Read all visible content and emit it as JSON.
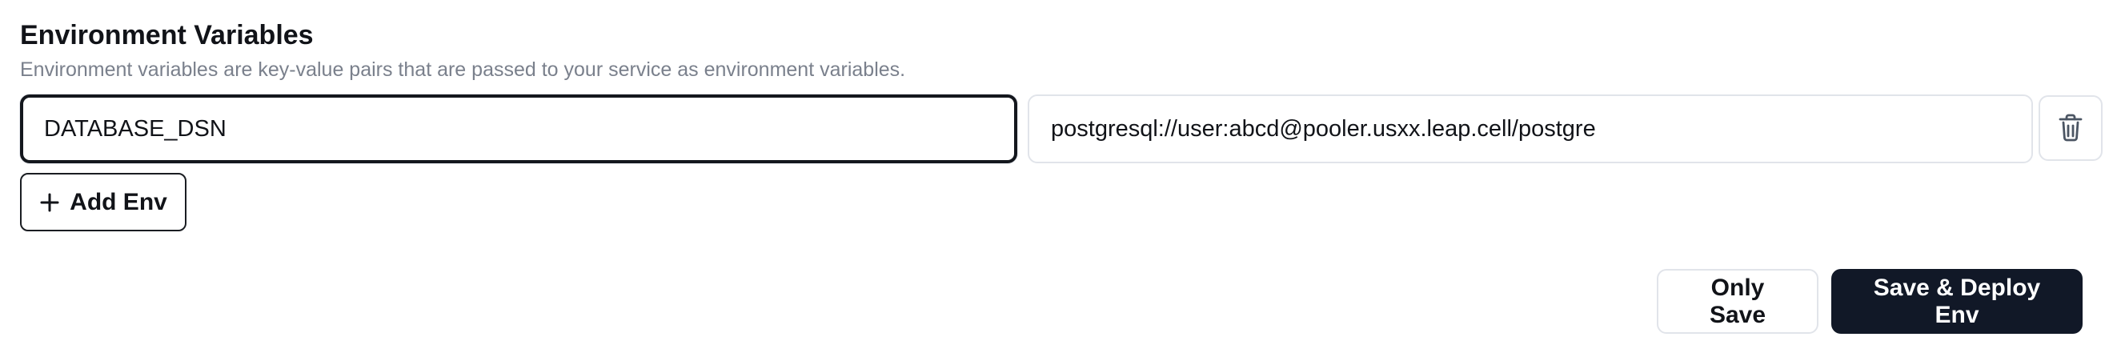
{
  "section": {
    "title": "Environment Variables",
    "description": "Environment variables are key-value pairs that are passed to your service as environment variables."
  },
  "env_vars": [
    {
      "key": "DATABASE_DSN",
      "value": "postgresql://user:abcd@pooler.usxx.leap.cell/postgre"
    }
  ],
  "icons": {
    "delete": "trash-icon",
    "add": "plus-icon"
  },
  "buttons": {
    "add_env": "Add Env",
    "only_save": "Only Save",
    "save_deploy": "Save & Deploy Env"
  },
  "colors": {
    "primary_button": "#111827",
    "focused_border": "#14171d",
    "border": "#e1e4ea",
    "muted_text": "#7a808c"
  }
}
